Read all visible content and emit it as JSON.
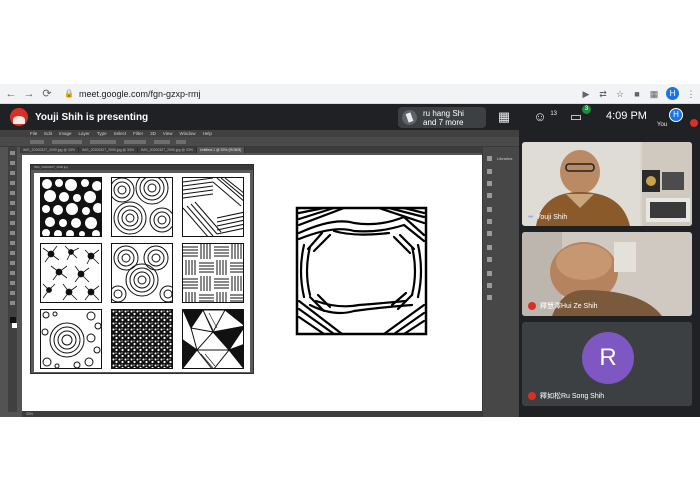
{
  "browser": {
    "url": "meet.google.com/fgn-gzxp-rmj",
    "profile_initial": "H"
  },
  "meet": {
    "presenting_text": "Youji Shih is presenting",
    "participants_chip": "ru hang Shi\nand 7 more",
    "people_count": "13",
    "chat_badge": "3",
    "clock": "4:09 PM",
    "you_label": "You",
    "you_initial": "H"
  },
  "photoshop": {
    "menu": [
      "File",
      "Edit",
      "Image",
      "Layer",
      "Type",
      "Select",
      "Filter",
      "3D",
      "View",
      "Window",
      "Help"
    ],
    "tabs": [
      "IMG_20200327_2090.jpg @ 33%",
      "IMG_20200327_2090.jpg @ 33%",
      "IMG_20200327_2090.jpg @ 33%",
      "Untitled-1 @ 33% (RGB/8)"
    ],
    "libraries_label": "Libraries",
    "status_text": "33%",
    "ref_caption": "IMG_20200327_2090.jpg"
  },
  "participants": [
    {
      "name": "Youji Shih",
      "muted": false
    },
    {
      "name": "釋慧澤Hui Ze Shih",
      "muted": true
    },
    {
      "name": "釋如松Ru Song Shih",
      "muted": true,
      "initial": "R"
    }
  ],
  "colors": {
    "meet_bg": "#202124",
    "mute_red": "#d93025",
    "avatar_purple": "#7e57c2",
    "brand_blue": "#1a73e8",
    "ps_gray": "#535353"
  }
}
